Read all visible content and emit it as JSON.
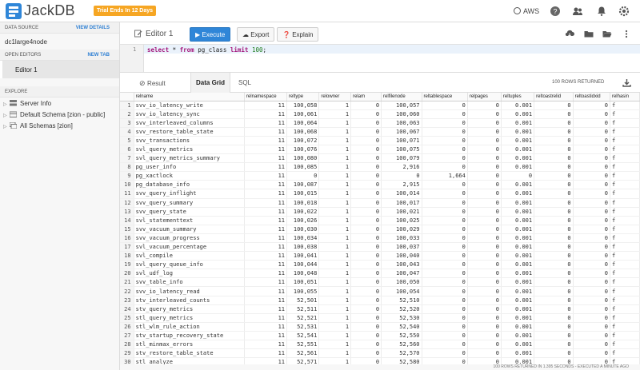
{
  "app": {
    "name": "JackDB",
    "trial_badge": "Trial Ends In 12 Days",
    "region": "AWS"
  },
  "colors": {
    "accent": "#2f86d8",
    "trial": "#f6a623",
    "link": "#2d7fd3"
  },
  "sidebar": {
    "data_source_header": "DATA SOURCE",
    "view_details": "VIEW DETAILS",
    "data_source": "dc1large4node",
    "open_editors_header": "OPEN EDITORS",
    "new_tab": "NEW TAB",
    "editor": "Editor 1",
    "explore_header": "EXPLORE",
    "tree": [
      {
        "label": "Server Info",
        "icon": "server-icon"
      },
      {
        "label": "Default Schema [zion - public]",
        "icon": "schema-icon"
      },
      {
        "label": "All Schemas [zion]",
        "icon": "schemas-icon"
      }
    ]
  },
  "editor": {
    "title": "Editor 1",
    "execute": "Execute",
    "export": "Export",
    "explain": "Explain",
    "line_number": "1",
    "sql": {
      "kw1": "select",
      "mid1": " * ",
      "kw2": "from",
      "mid2": " pg_class ",
      "kw3": "limit",
      "sp": " ",
      "limit": "100",
      "end": ";"
    }
  },
  "results": {
    "tab_result": "Result",
    "tab_grid": "Data Grid",
    "tab_sql": "SQL",
    "rows_returned": "100 ROWS RETURNED",
    "footer": "100 ROWS RETURNED IN 1.395 SECONDS - EXECUTED A MINUTE AGO",
    "columns": [
      "relname",
      "relnamespace",
      "reltype",
      "relowner",
      "relam",
      "relfilenode",
      "reltablespace",
      "relpages",
      "reltuples",
      "reltoastrelid",
      "reltoastidxid",
      "relhasin"
    ],
    "rows": [
      [
        "1",
        "svv_io_latency_write",
        "11",
        "100,058",
        "1",
        "0",
        "100,057",
        "0",
        "0",
        "0.001",
        "0",
        "0",
        "f"
      ],
      [
        "2",
        "svv_io_latency_sync",
        "11",
        "100,061",
        "1",
        "0",
        "100,060",
        "0",
        "0",
        "0.001",
        "0",
        "0",
        "f"
      ],
      [
        "3",
        "svv_interleaved_columns",
        "11",
        "100,064",
        "1",
        "0",
        "100,063",
        "0",
        "0",
        "0.001",
        "0",
        "0",
        "f"
      ],
      [
        "4",
        "svv_restore_table_state",
        "11",
        "100,068",
        "1",
        "0",
        "100,067",
        "0",
        "0",
        "0.001",
        "0",
        "0",
        "f"
      ],
      [
        "5",
        "svv_transactions",
        "11",
        "100,072",
        "1",
        "0",
        "100,071",
        "0",
        "0",
        "0.001",
        "0",
        "0",
        "f"
      ],
      [
        "6",
        "svl_query_metrics",
        "11",
        "100,076",
        "1",
        "0",
        "100,075",
        "0",
        "0",
        "0.001",
        "0",
        "0",
        "f"
      ],
      [
        "7",
        "svl_query_metrics_summary",
        "11",
        "100,080",
        "1",
        "0",
        "100,079",
        "0",
        "0",
        "0.001",
        "0",
        "0",
        "f"
      ],
      [
        "8",
        "pg_user_info",
        "11",
        "100,085",
        "1",
        "0",
        "2,916",
        "0",
        "0",
        "0.001",
        "0",
        "0",
        "f"
      ],
      [
        "9",
        "pg_xactlock",
        "11",
        "0",
        "1",
        "0",
        "0",
        "1,664",
        "0",
        "0",
        "0",
        "0",
        "f"
      ],
      [
        "10",
        "pg_database_info",
        "11",
        "100,087",
        "1",
        "0",
        "2,915",
        "0",
        "0",
        "0.001",
        "0",
        "0",
        "f"
      ],
      [
        "11",
        "svv_query_inflight",
        "11",
        "100,015",
        "1",
        "0",
        "100,014",
        "0",
        "0",
        "0.001",
        "0",
        "0",
        "f"
      ],
      [
        "12",
        "svv_query_summary",
        "11",
        "100,018",
        "1",
        "0",
        "100,017",
        "0",
        "0",
        "0.001",
        "0",
        "0",
        "f"
      ],
      [
        "13",
        "svv_query_state",
        "11",
        "100,022",
        "1",
        "0",
        "100,021",
        "0",
        "0",
        "0.001",
        "0",
        "0",
        "f"
      ],
      [
        "14",
        "svl_statementtext",
        "11",
        "100,026",
        "1",
        "0",
        "100,025",
        "0",
        "0",
        "0.001",
        "0",
        "0",
        "f"
      ],
      [
        "15",
        "svv_vacuum_summary",
        "11",
        "100,030",
        "1",
        "0",
        "100,029",
        "0",
        "0",
        "0.001",
        "0",
        "0",
        "f"
      ],
      [
        "16",
        "svv_vacuum_progress",
        "11",
        "100,034",
        "1",
        "0",
        "100,033",
        "0",
        "0",
        "0.001",
        "0",
        "0",
        "f"
      ],
      [
        "17",
        "svl_vacuum_percentage",
        "11",
        "100,038",
        "1",
        "0",
        "100,037",
        "0",
        "0",
        "0.001",
        "0",
        "0",
        "f"
      ],
      [
        "18",
        "svl_compile",
        "11",
        "100,041",
        "1",
        "0",
        "100,040",
        "0",
        "0",
        "0.001",
        "0",
        "0",
        "f"
      ],
      [
        "19",
        "svl_query_queue_info",
        "11",
        "100,044",
        "1",
        "0",
        "100,043",
        "0",
        "0",
        "0.001",
        "0",
        "0",
        "f"
      ],
      [
        "20",
        "svl_udf_log",
        "11",
        "100,048",
        "1",
        "0",
        "100,047",
        "0",
        "0",
        "0.001",
        "0",
        "0",
        "f"
      ],
      [
        "21",
        "svv_table_info",
        "11",
        "100,051",
        "1",
        "0",
        "100,050",
        "0",
        "0",
        "0.001",
        "0",
        "0",
        "f"
      ],
      [
        "22",
        "svv_io_latency_read",
        "11",
        "100,055",
        "1",
        "0",
        "100,054",
        "0",
        "0",
        "0.001",
        "0",
        "0",
        "f"
      ],
      [
        "23",
        "stv_interleaved_counts",
        "11",
        "52,501",
        "1",
        "0",
        "52,510",
        "0",
        "0",
        "0.001",
        "0",
        "0",
        "f"
      ],
      [
        "24",
        "stv_query_metrics",
        "11",
        "52,511",
        "1",
        "0",
        "52,520",
        "0",
        "0",
        "0.001",
        "0",
        "0",
        "f"
      ],
      [
        "25",
        "stl_query_metrics",
        "11",
        "52,521",
        "1",
        "0",
        "52,530",
        "0",
        "0",
        "0.001",
        "0",
        "0",
        "f"
      ],
      [
        "26",
        "stl_wlm_rule_action",
        "11",
        "52,531",
        "1",
        "0",
        "52,540",
        "0",
        "0",
        "0.001",
        "0",
        "0",
        "f"
      ],
      [
        "27",
        "stv_startup_recovery_state",
        "11",
        "52,541",
        "1",
        "0",
        "52,550",
        "0",
        "0",
        "0.001",
        "0",
        "0",
        "f"
      ],
      [
        "28",
        "stl_minmax_errors",
        "11",
        "52,551",
        "1",
        "0",
        "52,560",
        "0",
        "0",
        "0.001",
        "0",
        "0",
        "f"
      ],
      [
        "29",
        "stv_restore_table_state",
        "11",
        "52,561",
        "1",
        "0",
        "52,570",
        "0",
        "0",
        "0.001",
        "0",
        "0",
        "f"
      ],
      [
        "30",
        "stl_analyze",
        "11",
        "52,571",
        "1",
        "0",
        "52,580",
        "0",
        "0",
        "0.001",
        "0",
        "0",
        "f"
      ]
    ]
  }
}
